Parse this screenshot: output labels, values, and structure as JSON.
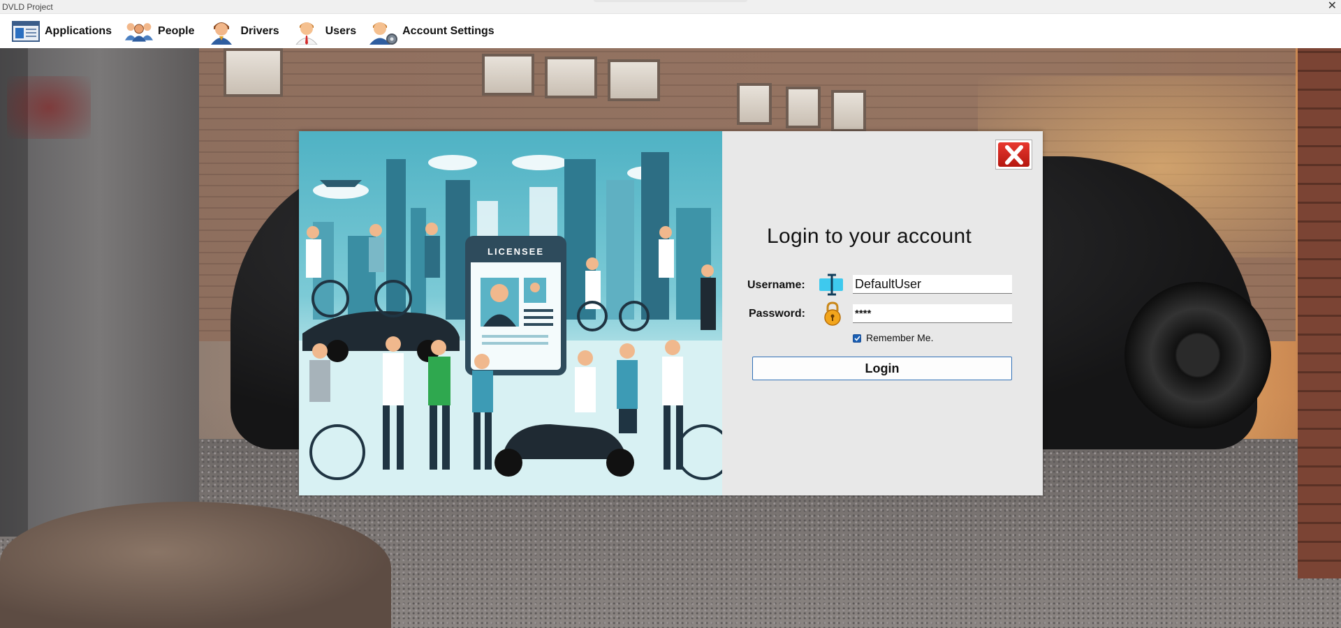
{
  "window": {
    "title": "DVLD Project",
    "close_glyph": "✕"
  },
  "menu": [
    {
      "label": "Applications",
      "icon": "applications-icon"
    },
    {
      "label": "People",
      "icon": "people-icon"
    },
    {
      "label": "Drivers",
      "icon": "driver-icon"
    },
    {
      "label": "Users",
      "icon": "user-icon"
    },
    {
      "label": "Account Settings",
      "icon": "account-settings-icon"
    }
  ],
  "illustration": {
    "badge_text": "LICENSEE"
  },
  "login": {
    "title": "Login to your account",
    "username_label": "Username:",
    "username_value": "DefaultUser",
    "password_label": "Password:",
    "password_value": "****",
    "remember_label": "Remember Me.",
    "remember_checked": true,
    "login_button": "Login"
  },
  "colors": {
    "close_button": "#d9271d",
    "login_border": "#2f6fb6",
    "checkbox": "#1a5fb4",
    "illustration_sky": "#4fb2c4"
  }
}
